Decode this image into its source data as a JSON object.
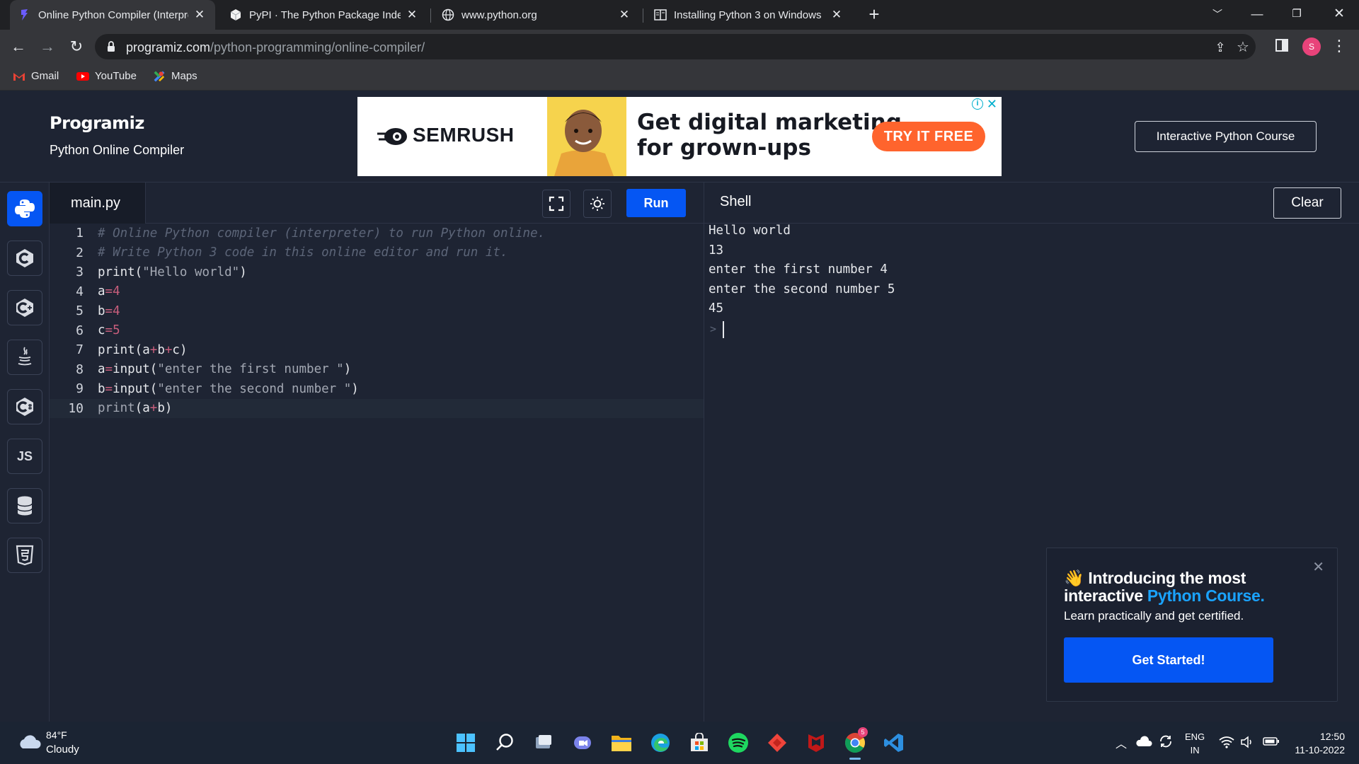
{
  "browser": {
    "tabs": [
      {
        "title": "Online Python Compiler (Interpreter)"
      },
      {
        "title": "PyPI · The Python Package Index"
      },
      {
        "title": "www.python.org"
      },
      {
        "title": "Installing Python 3 on Windows"
      }
    ],
    "url_host": "programiz.com",
    "url_path": "/python-programming/online-compiler/",
    "profile_initial": "S",
    "bookmarks": [
      {
        "label": "Gmail"
      },
      {
        "label": "YouTube"
      },
      {
        "label": "Maps"
      }
    ]
  },
  "site": {
    "logo": "Programiz",
    "subtitle": "Python Online Compiler",
    "course_button": "Interactive Python Course"
  },
  "ad": {
    "brand": "SEMRUSH",
    "headline_line1": "Get digital marketing",
    "headline_line2": "for grown-ups",
    "cta": "TRY IT FREE",
    "adchoice": "i",
    "close": "✕",
    "brand_color": "#ff642d"
  },
  "rail": {
    "js_label": "JS"
  },
  "editor": {
    "filename": "main.py",
    "run_label": "Run",
    "line_numbers": [
      "1",
      "2",
      "3",
      "4",
      "5",
      "6",
      "7",
      "8",
      "9",
      "10"
    ],
    "lines": {
      "l1": "# Online Python compiler (interpreter) to run Python online.",
      "l2": "# Write Python 3 code in this online editor and run it.",
      "l3_fn": "print(",
      "l3_str": "\"Hello world\"",
      "l3_end": ")",
      "l4_var": "a",
      "l4_val": "=4",
      "l5_var": "b",
      "l5_val": "=4",
      "l6_var": "c",
      "l6_val": "=5",
      "l7_a": "print(a",
      "l7_p1": "+",
      "l7_b": "b",
      "l7_p2": "+",
      "l7_c": "c)",
      "l8_var": "a",
      "l8_eq": "=",
      "l8_fn": "input(",
      "l8_str": "\"enter the first number \"",
      "l8_end": ")",
      "l9_var": "b",
      "l9_eq": "=",
      "l9_fn": "input(",
      "l9_str": "\"enter the second number \"",
      "l9_end": ")",
      "l10_fn": "print",
      "l10_a": "(a",
      "l10_p": "+",
      "l10_b": "b)"
    }
  },
  "shell": {
    "title": "Shell",
    "clear_label": "Clear",
    "output": [
      "Hello world",
      "13",
      "enter the first number 4",
      "enter the second number 5",
      "45"
    ],
    "prompt": ">"
  },
  "promo": {
    "title_part1": "👋 Introducing the most interactive ",
    "title_accent": "Python Course.",
    "subtitle": "Learn practically and get certified.",
    "button": "Get Started!",
    "close": "✕"
  },
  "taskbar": {
    "temperature": "84°F",
    "condition": "Cloudy",
    "lang_line1": "ENG",
    "lang_line2": "IN",
    "time": "12:50",
    "date": "11-10-2022",
    "chrome_badge": "5"
  }
}
